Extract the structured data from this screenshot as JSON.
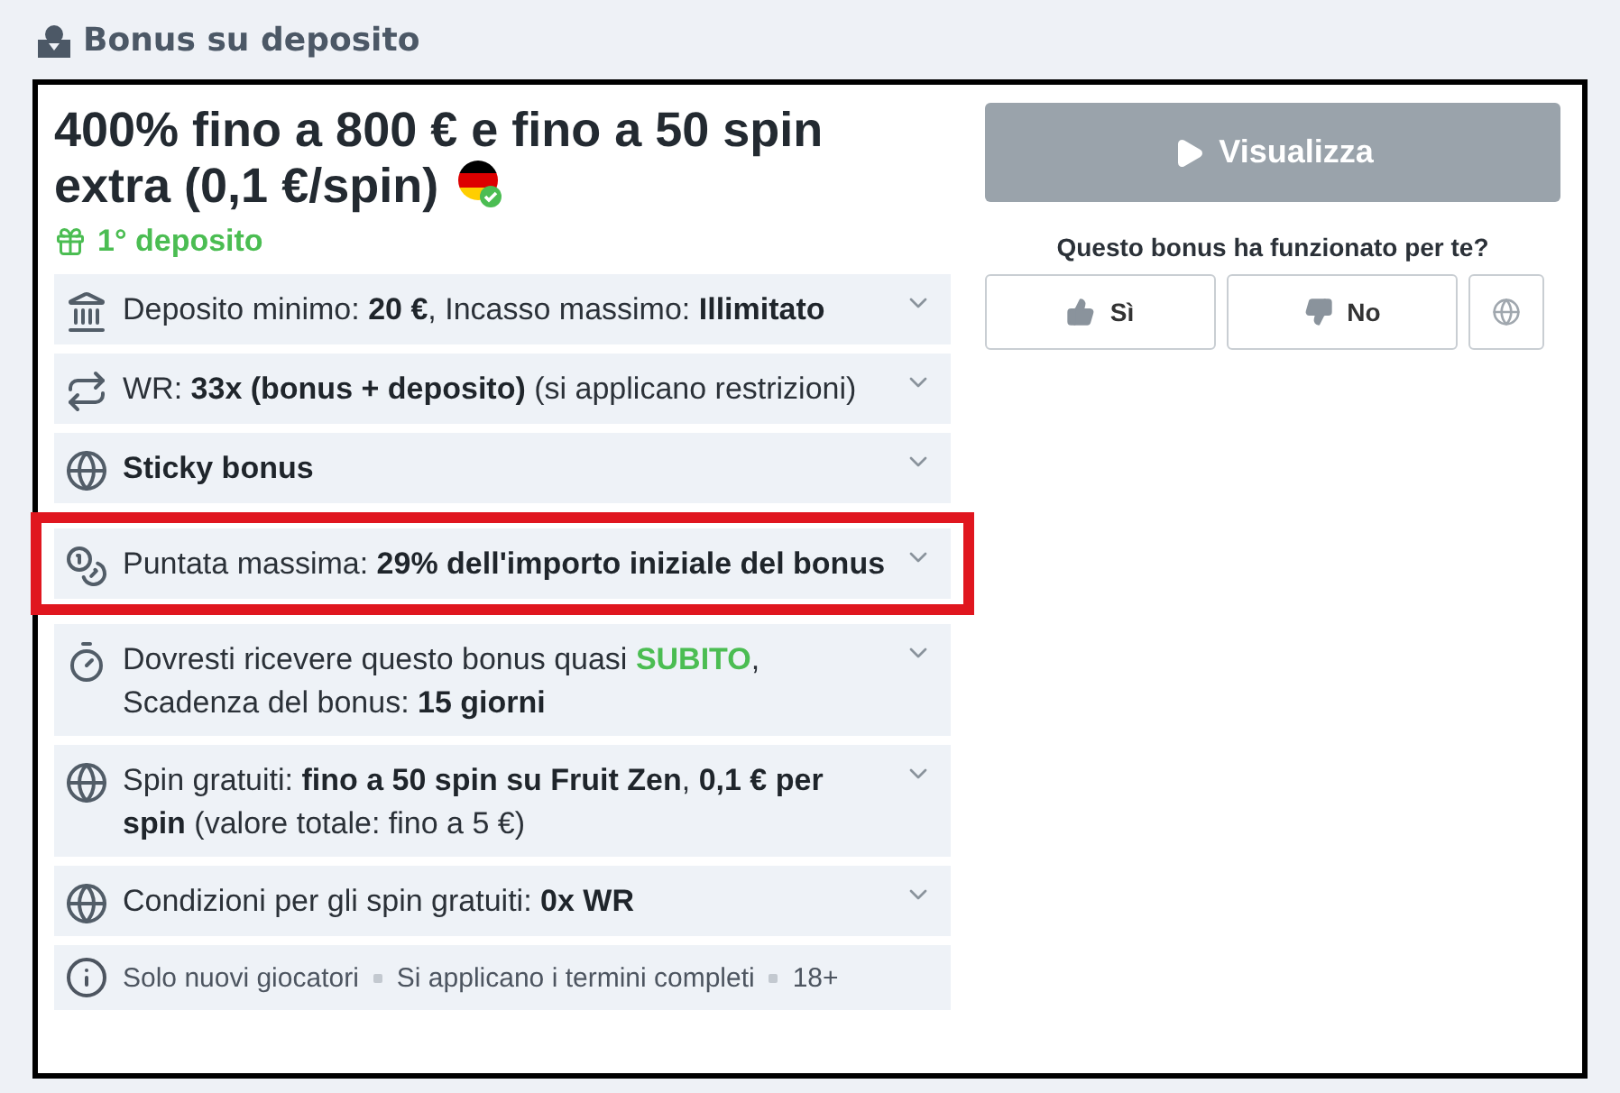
{
  "section": {
    "title": "Bonus su deposito"
  },
  "offer": {
    "title": "400% fino a 800 € e fino a 50 spin extra (0,1 €/spin)",
    "verified": true,
    "tag": "1° deposito"
  },
  "details": [
    {
      "kind": "deposit",
      "highlighted": false,
      "parts": [
        {
          "text": "Deposito minimo: ",
          "kind": "plain"
        },
        {
          "text": "20 €",
          "kind": "bold"
        },
        {
          "text": ", Incasso massimo: ",
          "kind": "plain"
        },
        {
          "text": "Illimitato",
          "kind": "bold"
        }
      ]
    },
    {
      "kind": "wager",
      "highlighted": false,
      "parts": [
        {
          "text": "WR: ",
          "kind": "plain"
        },
        {
          "text": "33x (bonus + deposito)",
          "kind": "bold"
        },
        {
          "text": " (si applicano restrizioni)",
          "kind": "plain"
        }
      ]
    },
    {
      "kind": "sticky",
      "highlighted": false,
      "parts": [
        {
          "text": "Sticky bonus",
          "kind": "bold"
        }
      ]
    },
    {
      "kind": "maxbet",
      "highlighted": true,
      "parts": [
        {
          "text": "Puntata massima: ",
          "kind": "plain"
        },
        {
          "text": "29% dell'importo iniziale del bonus",
          "kind": "bold"
        }
      ]
    },
    {
      "kind": "timer",
      "highlighted": false,
      "parts": [
        {
          "text": "Dovresti ricevere questo bonus quasi ",
          "kind": "plain"
        },
        {
          "text": "SUBITO",
          "kind": "accent"
        },
        {
          "text": ", Scadenza del bonus: ",
          "kind": "plain"
        },
        {
          "text": "15 giorni",
          "kind": "bold"
        }
      ]
    },
    {
      "kind": "spins",
      "highlighted": false,
      "parts": [
        {
          "text": "Spin gratuiti: ",
          "kind": "plain"
        },
        {
          "text": "fino a 50 spin su Fruit Zen",
          "kind": "bold"
        },
        {
          "text": ", ",
          "kind": "plain"
        },
        {
          "text": "0,1 € per spin",
          "kind": "bold"
        },
        {
          "text": " (valore totale: fino a 5 €)",
          "kind": "plain"
        }
      ]
    },
    {
      "kind": "spinrules",
      "highlighted": false,
      "parts": [
        {
          "text": "Condizioni per gli spin gratuiti: ",
          "kind": "plain"
        },
        {
          "text": "0x WR",
          "kind": "bold"
        }
      ]
    }
  ],
  "footer": [
    "Solo nuovi giocatori",
    "Si applicano i termini completi",
    "18+"
  ],
  "actions": {
    "primary": "Visualizza",
    "disabled": true,
    "question": "Questo bonus ha funzionato per te?",
    "yes": "Sì",
    "no": "No"
  }
}
